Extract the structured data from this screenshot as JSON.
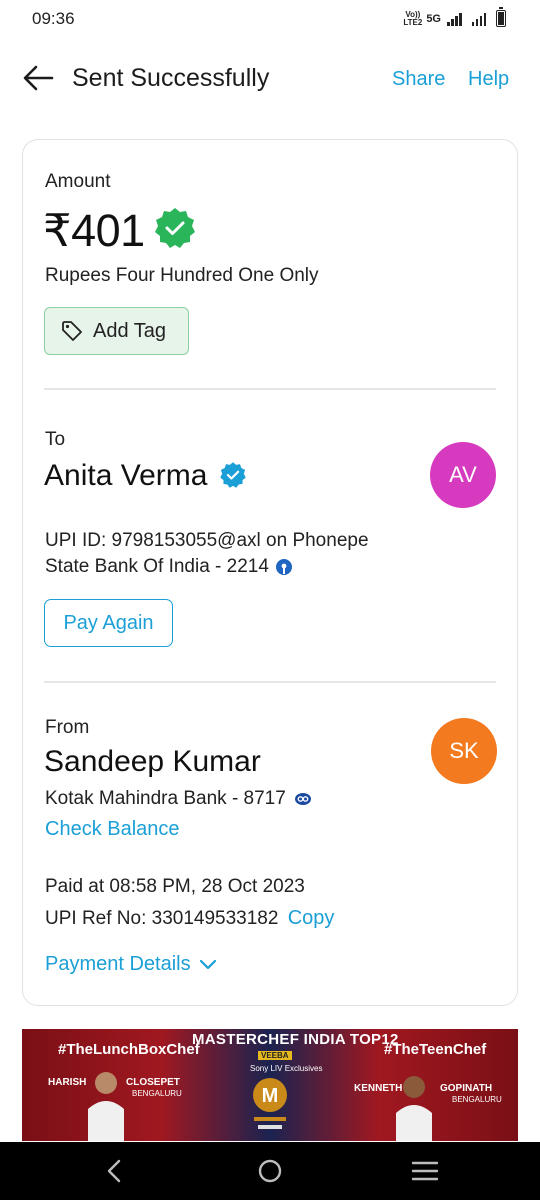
{
  "status_bar": {
    "time": "09:36",
    "lte_line1": "Vo))",
    "lte_line2": "LTE2",
    "network": "5G"
  },
  "header": {
    "title": "Sent Successfully",
    "share_label": "Share",
    "help_label": "Help"
  },
  "amount": {
    "label": "Amount",
    "value": "₹401",
    "words": "Rupees Four Hundred One Only",
    "add_tag_label": "Add Tag"
  },
  "to": {
    "label": "To",
    "name": "Anita Verma",
    "initials": "AV",
    "upi_id": "UPI ID: 9798153055@axl on Phonepe",
    "bank": "State Bank Of India - 2214",
    "pay_again_label": "Pay Again"
  },
  "from": {
    "label": "From",
    "name": "Sandeep Kumar",
    "initials": "SK",
    "bank": "Kotak Mahindra Bank - 8717",
    "check_balance_label": "Check Balance"
  },
  "transaction": {
    "paid_at": "Paid at 08:58 PM, 28 Oct 2023",
    "ref_label": "UPI Ref No: 330149533182",
    "copy_label": "Copy",
    "payment_details_label": "Payment Details"
  },
  "banner": {
    "left_tag": "#TheLunchBoxChef",
    "title": "MASTERCHEF INDIA TOP12",
    "right_tag": "#TheTeenChef",
    "left_first": "HARISH",
    "left_last": "CLOSEPET",
    "left_city": "BENGALURU",
    "right_first": "KENNETH",
    "right_last": "GOPINATH",
    "right_city": "BENGALURU",
    "sponsor": "VEEBA",
    "platform": "Sony LIV Exclusives"
  },
  "colors": {
    "accent": "#1a9fd6",
    "success": "#2bb55a",
    "payee_avatar": "#d63bbf",
    "payer_avatar": "#f47a1f"
  },
  "icons": {
    "back": "arrow-left-icon",
    "verified": "verified-badge-icon",
    "tag": "tag-icon",
    "chevron": "chevron-down-icon"
  }
}
